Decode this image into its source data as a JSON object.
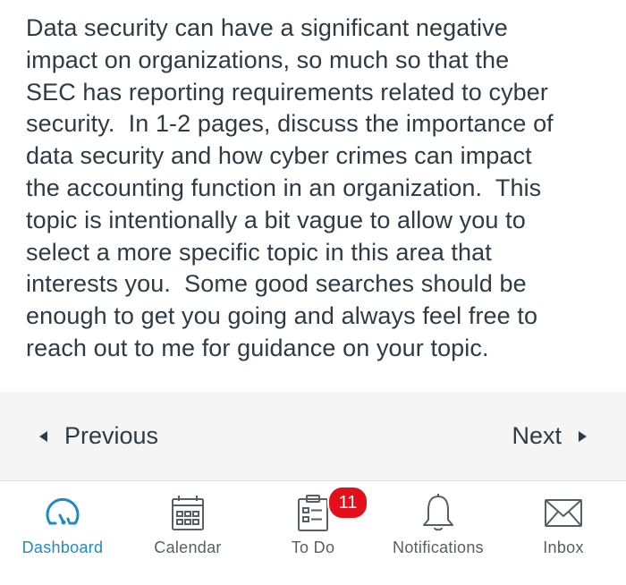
{
  "assignment": {
    "description_lines": [
      "Data security can have a significant negative",
      "impact on organizations, so much so that the",
      "SEC has reporting requirements related to cyber",
      "security.  In 1-2 pages, discuss the importance of",
      "data security and how cyber crimes can impact",
      "the accounting function in an organization.  This",
      "topic is intentionally a bit vague to allow you to",
      "select a more specific topic in this area that",
      "interests you.  Some good searches should be",
      "enough to get you going and always feel free to",
      "reach out to me for guidance on your topic."
    ]
  },
  "pager": {
    "previous_label": "Previous",
    "next_label": "Next"
  },
  "tabbar": {
    "active": "Dashboard",
    "items": [
      {
        "label": "Dashboard",
        "icon": "dashboard-gauge-icon"
      },
      {
        "label": "Calendar",
        "icon": "calendar-icon"
      },
      {
        "label": "To Do",
        "icon": "todo-clipboard-icon",
        "badge": "11"
      },
      {
        "label": "Notifications",
        "icon": "bell-icon"
      },
      {
        "label": "Inbox",
        "icon": "envelope-icon"
      }
    ]
  },
  "colors": {
    "text": "#2d3b45",
    "active_tab": "#1f8ac9",
    "inactive_tab": "#555f66",
    "badge": "#e3101b",
    "pager_background": "#f5f5f5"
  }
}
